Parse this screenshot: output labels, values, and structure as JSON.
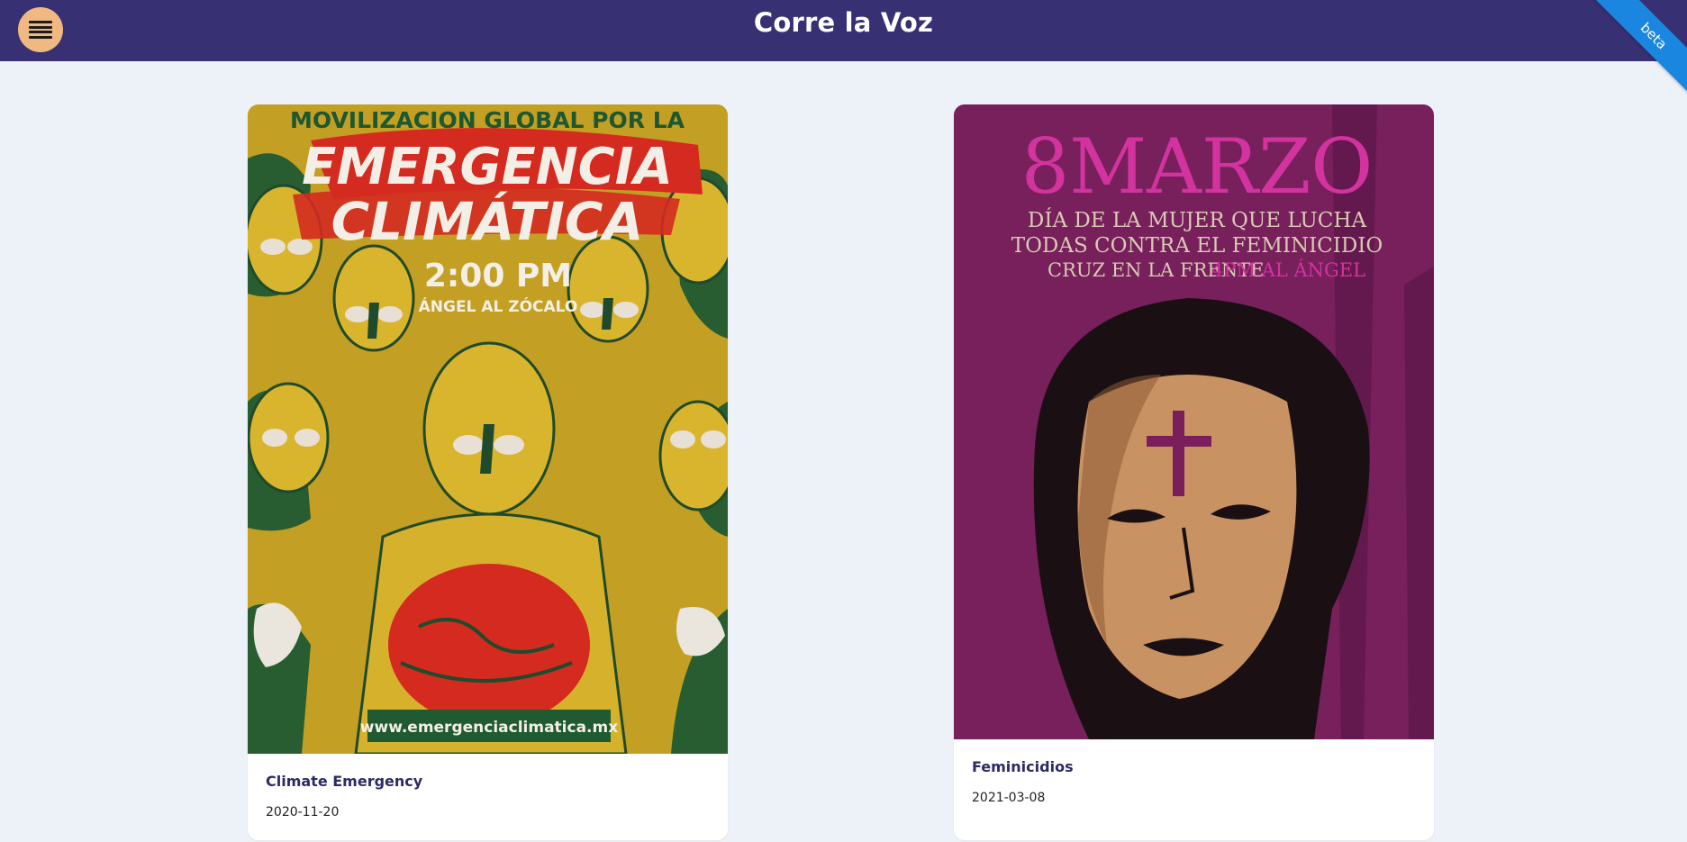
{
  "header": {
    "title": "Corre la Voz",
    "beta_label": "beta"
  },
  "colors": {
    "header_bg": "#373174",
    "page_bg": "#edf2f8",
    "menu_button": "#f1b982",
    "beta_ribbon": "#1a86e0",
    "card_title": "#2d2a66"
  },
  "posts": [
    {
      "title": "Climate Emergency",
      "date": "2020-11-20",
      "poster": {
        "top_line": "MOVILIZACION GLOBAL POR LA",
        "headline_1": "EMERGENCIA",
        "headline_2": "CLIMÁTICA",
        "time": "2:00 PM",
        "route": "ÁNGEL AL ZÓCALO",
        "website": "www.emergenciaclimatica.mx"
      }
    },
    {
      "title": "Feminicidios",
      "date": "2021-03-08",
      "poster": {
        "headline": "8MARZO",
        "line_1": "DÍA DE LA MUJER QUE LUCHA",
        "line_2": "TODAS CONTRA EL FEMINICIDIO",
        "line_3a": "CRUZ EN LA FRENTE",
        "line_3b": "4PM AL ÁNGEL"
      }
    }
  ],
  "icons": {
    "menu": "hamburger-menu-icon"
  }
}
